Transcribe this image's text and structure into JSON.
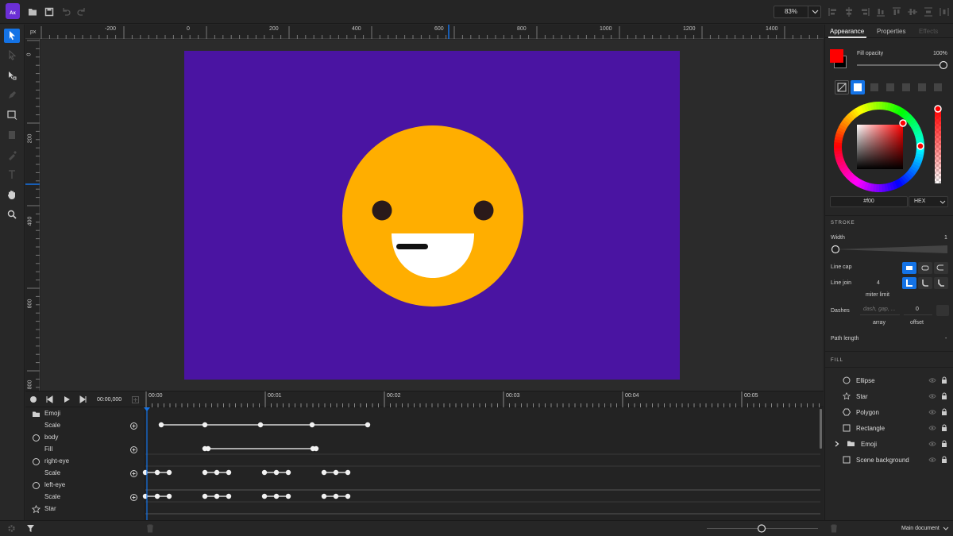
{
  "app": {
    "logo_text": "Ax"
  },
  "toolbar_top": {
    "zoom_value": "83%"
  },
  "ruler": {
    "unit": "px",
    "h_labels": [
      "-200",
      "0",
      "200",
      "400",
      "600",
      "800",
      "1000",
      "1200",
      "1400"
    ],
    "v_labels": [
      "0",
      "200",
      "400",
      "600",
      "800"
    ]
  },
  "colors": {
    "artboard": "#4a14a2",
    "face": "#ffae00",
    "eye": "#2a1a1a",
    "mouth": "#ffffff",
    "accent": "#1473e6",
    "fill_swatch": "#ff0000"
  },
  "timeline": {
    "timecode": "00:00,000",
    "ticks": [
      "00:00",
      "00:01",
      "00:02",
      "00:03",
      "00:04",
      "00:05"
    ],
    "rows": [
      {
        "label": "Emoji",
        "icon": "folder-icon"
      },
      {
        "label": "Scale",
        "icon": ""
      },
      {
        "label": "body",
        "icon": "ellipse-icon"
      },
      {
        "label": "Fill",
        "icon": ""
      },
      {
        "label": "right-eye",
        "icon": "ellipse-icon"
      },
      {
        "label": "Scale",
        "icon": ""
      },
      {
        "label": "left-eye",
        "icon": "ellipse-icon"
      },
      {
        "label": "Scale",
        "icon": ""
      },
      {
        "label": "Star",
        "icon": "star-icon"
      }
    ]
  },
  "status": {
    "document": "Main document"
  },
  "panel": {
    "tabs": [
      "Appearance",
      "Properties",
      "Effects"
    ],
    "fill_opacity_label": "Fill opacity",
    "fill_opacity_value": "100%",
    "fill_opacity": 1.0,
    "hex_value": "#f00",
    "color_mode": "HEX",
    "stroke_title": "STROKE",
    "width_label": "Width",
    "width_value": "1",
    "line_cap_label": "Line cap",
    "line_join_label": "Line join",
    "miter_value": "4",
    "miter_label": "miter limit",
    "dashes_label": "Dashes",
    "dash_placeholder": "dash, gap, ...",
    "offset_value": "0",
    "array_label": "array",
    "offset_label": "offset",
    "path_length_label": "Path length",
    "path_length_value": "-",
    "fill_title": "FILL"
  },
  "layers": [
    {
      "label": "Ellipse",
      "icon": "ellipse-icon"
    },
    {
      "label": "Star",
      "icon": "star-icon"
    },
    {
      "label": "Polygon",
      "icon": "polygon-icon"
    },
    {
      "label": "Rectangle",
      "icon": "rectangle-icon"
    },
    {
      "label": "Emoji",
      "icon": "folder-icon"
    },
    {
      "label": "Scene background",
      "icon": "rectangle-icon"
    }
  ]
}
